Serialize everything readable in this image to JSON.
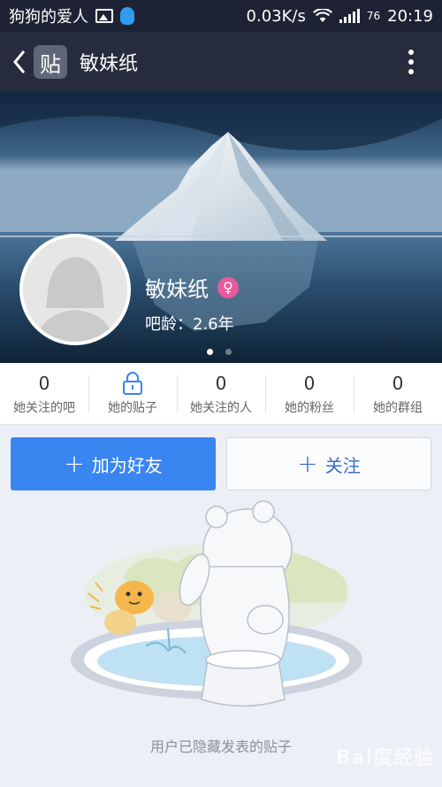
{
  "status_bar": {
    "carrier_text": "狗狗的爱人",
    "network_speed": "0.03K/s",
    "battery": "76",
    "time": "20:19",
    "icons": [
      "image-icon",
      "qq-icon",
      "wifi-icon",
      "signal-icon"
    ]
  },
  "header": {
    "logo_text": "贴",
    "title": "敏妹纸"
  },
  "profile": {
    "name": "敏妹纸",
    "gender_icon": "female-icon",
    "gender_symbol": "♀",
    "age_label": "吧龄：",
    "age_value": "2.6年",
    "banner_pages": 2,
    "active_page": 1
  },
  "stats": [
    {
      "value": "0",
      "label": "她关注的吧"
    },
    {
      "value": "",
      "label": "她的贴子",
      "icon": "lock-icon"
    },
    {
      "value": "0",
      "label": "她关注的人"
    },
    {
      "value": "0",
      "label": "她的粉丝"
    },
    {
      "value": "0",
      "label": "她的群组"
    }
  ],
  "actions": {
    "add_friend_label": "加为好友",
    "follow_label": "关注",
    "plus_symbol": "+"
  },
  "empty_state": {
    "message": "用户已隐藏发表的贴子"
  },
  "watermark": "Bai度经验",
  "colors": {
    "header_bg": "#262c3e",
    "accent_blue": "#3a86f1",
    "female_pink": "#e85a9c"
  }
}
